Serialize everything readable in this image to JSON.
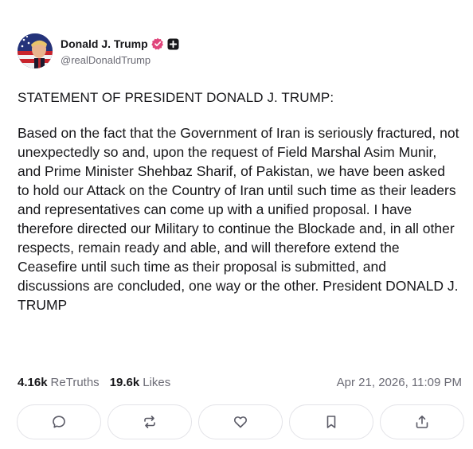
{
  "author": {
    "display_name": "Donald J. Trump",
    "handle": "@realDonaldTrump",
    "verified_color": "#e0457b"
  },
  "post": {
    "title": "STATEMENT OF PRESIDENT DONALD J. TRUMP:",
    "body": "Based on the fact that the Government of Iran is seriously fractured, not unexpectedly so and, upon the request of Field Marshal Asim Munir, and Prime Minister Shehbaz Sharif, of Pakistan, we have been asked to hold our Attack on the Country of Iran until such time as their leaders and representatives can come up with a unified proposal. I have therefore directed our Military to continue the Blockade and, in all other respects, remain ready and able, and will therefore extend the Ceasefire until such time as their proposal is submitted, and discussions are concluded, one way or the other. President DONALD J. TRUMP"
  },
  "stats": {
    "retruths_count": "4.16k",
    "retruths_label": "ReTruths",
    "likes_count": "19.6k",
    "likes_label": "Likes",
    "timestamp": "Apr 21, 2026, 11:09 PM"
  },
  "actions": [
    {
      "name": "reply",
      "icon": "comment-icon"
    },
    {
      "name": "retruth",
      "icon": "repost-icon"
    },
    {
      "name": "like",
      "icon": "heart-icon"
    },
    {
      "name": "bookmark",
      "icon": "bookmark-icon"
    },
    {
      "name": "share",
      "icon": "share-icon"
    }
  ]
}
